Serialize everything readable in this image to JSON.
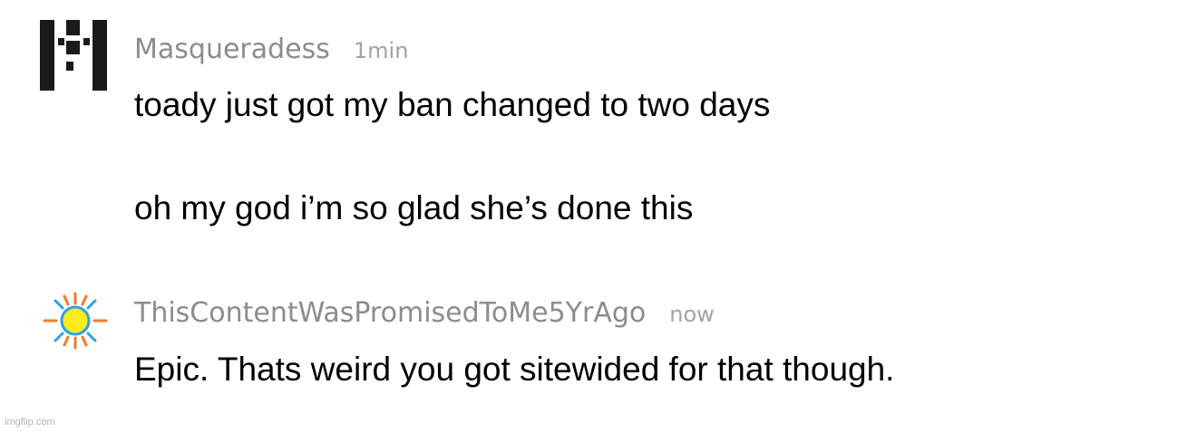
{
  "comments": [
    {
      "avatar_icon": "pixel-m-avatar-icon",
      "username": "Masqueradess",
      "time": "1min",
      "lines": [
        "toady just got my ban changed to two days",
        "oh my god i’m so glad she’s done this"
      ]
    },
    {
      "avatar_icon": "sun-avatar-icon",
      "username": "ThisContentWasPromisedToMe5YrAgo",
      "time": "now",
      "lines": [
        "Epic. Thats weird you got sitewided for that though."
      ]
    }
  ],
  "watermark": "imgflip.com",
  "colors": {
    "username": "#8c8c8c",
    "time": "#a3a3a3",
    "text": "#000000",
    "sun_core": "#ffec1a",
    "sun_ray_blue": "#29a3e8",
    "sun_ray_orange": "#f27a2e",
    "pixel_avatar": "#1a1a1a"
  }
}
